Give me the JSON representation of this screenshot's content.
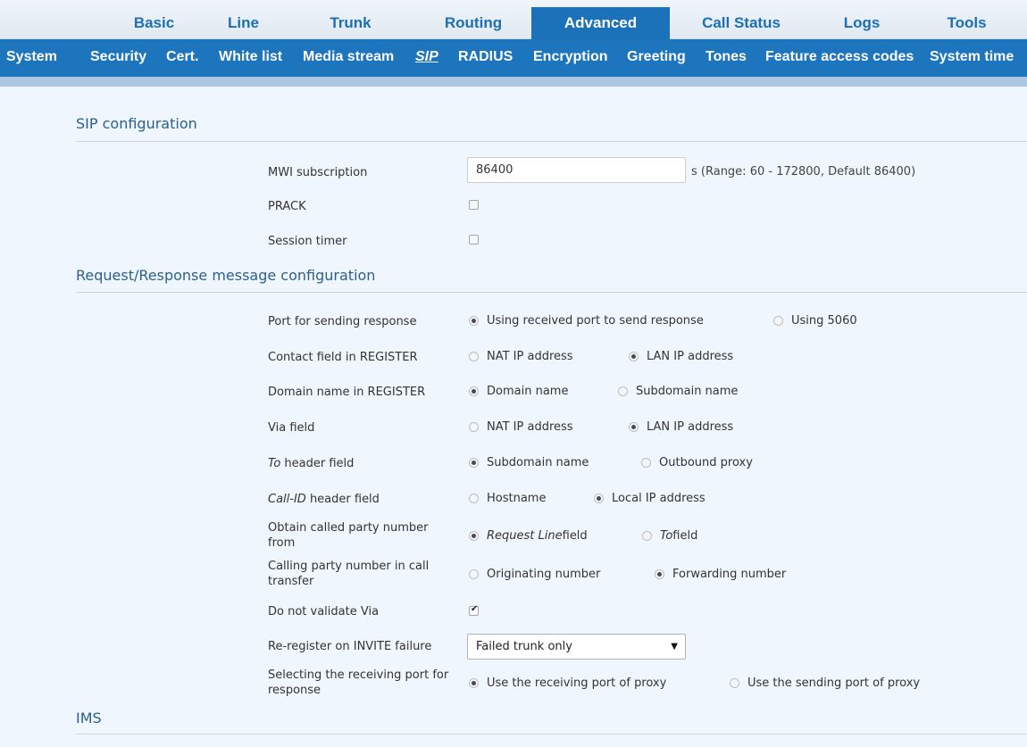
{
  "topnav": {
    "tabs": [
      {
        "label": "Basic"
      },
      {
        "label": "Line"
      },
      {
        "label": "Trunk"
      },
      {
        "label": "Routing"
      },
      {
        "label": "Advanced"
      },
      {
        "label": "Call Status"
      },
      {
        "label": "Logs"
      },
      {
        "label": "Tools"
      }
    ],
    "active": "Advanced"
  },
  "subnav": {
    "items": [
      {
        "label": "System"
      },
      {
        "label": "Security"
      },
      {
        "label": "Cert."
      },
      {
        "label": "White list"
      },
      {
        "label": "Media stream"
      },
      {
        "label": "SIP"
      },
      {
        "label": "RADIUS"
      },
      {
        "label": "Encryption"
      },
      {
        "label": "Greeting"
      },
      {
        "label": "Tones"
      },
      {
        "label": "Feature access codes"
      },
      {
        "label": "System time"
      }
    ],
    "active": "SIP"
  },
  "sip_config": {
    "title": "SIP configuration",
    "mwi_label": "MWI subscription",
    "mwi_value": "86400",
    "mwi_hint": "s (Range: 60 - 172800, Default 86400)",
    "prack_label": "PRACK",
    "prack_checked": false,
    "session_timer_label": "Session timer",
    "session_timer_checked": false
  },
  "reqresp": {
    "title": "Request/Response message configuration",
    "port_label": "Port for sending response",
    "port_opt1": "Using received port to send response",
    "port_opt2": "Using 5060",
    "contact_label": "Contact field in REGISTER",
    "contact_opt1": "NAT IP address",
    "contact_opt2": "LAN IP address",
    "domain_label": "Domain name in REGISTER",
    "domain_opt1": "Domain name",
    "domain_opt2": "Subdomain name",
    "via_label": "Via field",
    "via_opt1": "NAT IP address",
    "via_opt2": "LAN IP address",
    "to_label_italic": "To",
    "to_label_rest": " header field",
    "to_opt1": "Subdomain name",
    "to_opt2": "Outbound proxy",
    "callid_label_italic": "Call-ID",
    "callid_label_rest": " header field",
    "callid_opt1": "Hostname",
    "callid_opt2": "Local IP address",
    "called_label": "Obtain called party number from",
    "called_opt1_italic": "Request Line",
    "called_opt1_rest": " field",
    "called_opt2_italic": "To",
    "called_opt2_rest": " field",
    "calling_label": "Calling party number in call transfer",
    "calling_opt1": "Originating number",
    "calling_opt2": "Forwarding number",
    "novia_label": "Do not validate Via",
    "novia_checked": true,
    "reregister_label": "Re-register on INVITE failure",
    "reregister_value": "Failed trunk only",
    "recvport_label": "Selecting the receiving port for response",
    "recvport_opt1": "Use the receiving port of proxy",
    "recvport_opt2": "Use the sending port of proxy"
  },
  "ims": {
    "title": "IMS"
  }
}
